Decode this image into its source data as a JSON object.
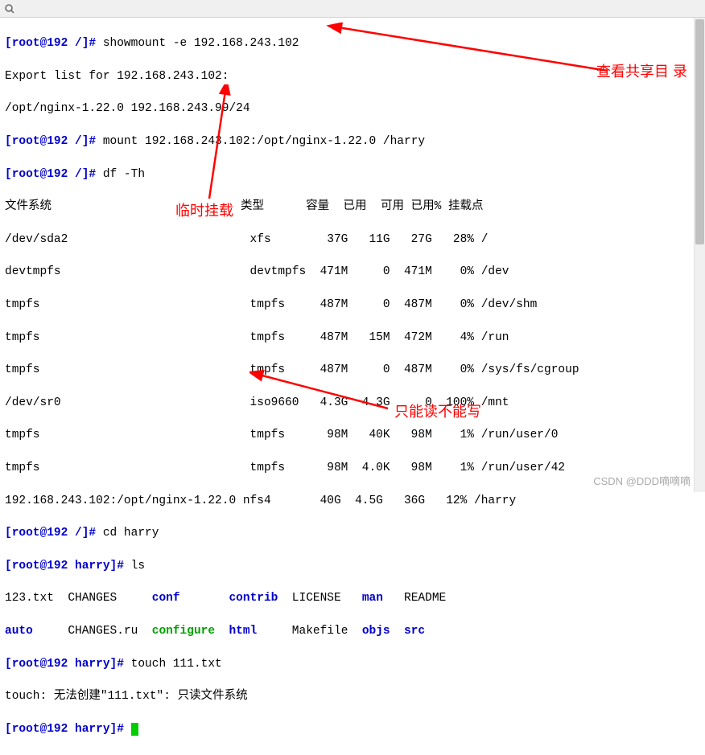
{
  "toolbar": {
    "icon_name": "search-icon"
  },
  "lines": {
    "l1_prompt_user": "[root@192 ",
    "l1_prompt_path": "/",
    "l1_prompt_end": "]#",
    "l1_cmd": " showmount -e 192.168.243.102",
    "l2": "Export list for 192.168.243.102:",
    "l3": "/opt/nginx-1.22.0 192.168.243.99/24",
    "l4_prompt_user": "[root@192 ",
    "l4_prompt_path": "/",
    "l4_prompt_end": "]#",
    "l4_cmd": " mount 192.168.243.102:/opt/nginx-1.22.0 /harry",
    "l5_prompt_user": "[root@192 ",
    "l5_prompt_path": "/",
    "l5_prompt_end": "]#",
    "l5_cmd": " df -Th",
    "l6": "文件系统                           类型      容量  已用  可用 已用% 挂载点",
    "l7": "/dev/sda2                          xfs        37G   11G   27G   28% /",
    "l8": "devtmpfs                           devtmpfs  471M     0  471M    0% /dev",
    "l9": "tmpfs                              tmpfs     487M     0  487M    0% /dev/shm",
    "l10": "tmpfs                              tmpfs     487M   15M  472M    4% /run",
    "l11": "tmpfs                              tmpfs     487M     0  487M    0% /sys/fs/cgroup",
    "l12": "/dev/sr0                           iso9660   4.3G  4.3G     0  100% /mnt",
    "l13": "tmpfs                              tmpfs      98M   40K   98M    1% /run/user/0",
    "l14": "tmpfs                              tmpfs      98M  4.0K   98M    1% /run/user/42",
    "l15": "192.168.243.102:/opt/nginx-1.22.0 nfs4       40G  4.5G   36G   12% /harry",
    "l16_prompt_user": "[root@192 ",
    "l16_prompt_path": "/",
    "l16_prompt_end": "]#",
    "l16_cmd": " cd harry",
    "l17_prompt_user": "[root@192 ",
    "l17_prompt_path": "harry",
    "l17_prompt_end": "]#",
    "l17_cmd": " ls",
    "ls_row1_c1": "123.txt  ",
    "ls_row1_c2": "CHANGES     ",
    "ls_row1_c3": "conf       ",
    "ls_row1_c4": "contrib  ",
    "ls_row1_c5": "LICENSE   ",
    "ls_row1_c6": "man   ",
    "ls_row1_c7": "README",
    "ls_row2_c1": "auto     ",
    "ls_row2_c2": "CHANGES.ru  ",
    "ls_row2_c3": "configure  ",
    "ls_row2_c4": "html     ",
    "ls_row2_c5": "Makefile  ",
    "ls_row2_c6": "objs  ",
    "ls_row2_c7": "src",
    "l20_prompt_user": "[root@192 ",
    "l20_prompt_path": "harry",
    "l20_prompt_end": "]#",
    "l20_cmd": " touch 111.txt",
    "l21": "touch: 无法创建\"111.txt\": 只读文件系统",
    "l22_prompt_user": "[root@192 ",
    "l22_prompt_path": "harry",
    "l22_prompt_end": "]#",
    "l22_cmd": " "
  },
  "annotations": {
    "a1": "查看共享目\n录",
    "a2": "临时挂载",
    "a3": "只能读不能写"
  },
  "watermark": "CSDN @DDD嘀嘀嘀"
}
